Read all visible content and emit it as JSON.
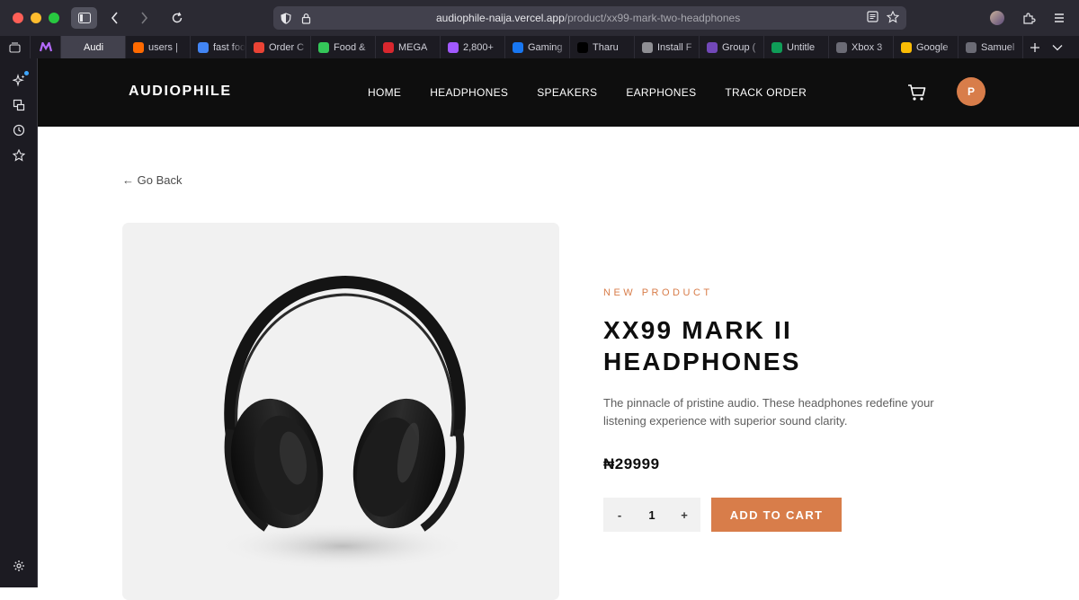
{
  "browser": {
    "url_host": "audiophile-naija.vercel.app",
    "url_path": "/product/xx99-mark-two-headphones",
    "tabs": [
      {
        "label": "Audi",
        "icon": "audiophile-favicon",
        "active": true,
        "color": "#42414d"
      },
      {
        "label": "users | ",
        "icon": "supabase-favicon",
        "color": "#ff6a00"
      },
      {
        "label": "fast foo",
        "icon": "google-favicon",
        "color": "#4285f4"
      },
      {
        "label": "Order C",
        "icon": "gmail-favicon",
        "color": "#ea4335"
      },
      {
        "label": "Food &",
        "icon": "food-app-favicon",
        "color": "#34c759"
      },
      {
        "label": "MEGA",
        "icon": "mega-favicon",
        "color": "#d9272e"
      },
      {
        "label": "2,800+",
        "icon": "figma-favicon",
        "color": "#a259ff"
      },
      {
        "label": "Gaming",
        "icon": "facebook-favicon",
        "color": "#1877f2"
      },
      {
        "label": "Tharu",
        "icon": "x-favicon",
        "color": "#000000"
      },
      {
        "label": "Install F",
        "icon": "globe-favicon",
        "color": "#8e8e93"
      },
      {
        "label": "Group (",
        "icon": "forms-favicon",
        "color": "#7248b9"
      },
      {
        "label": "Untitle",
        "icon": "sheets-favicon",
        "color": "#0f9d58"
      },
      {
        "label": "Xbox 3",
        "icon": "controller-favicon",
        "color": "#6b6b75"
      },
      {
        "label": "Google",
        "icon": "google-photos-favicon",
        "color": "#fbbc05"
      },
      {
        "label": "Samuel",
        "icon": "pin-favicon",
        "color": "#6b6b75"
      }
    ]
  },
  "nav": {
    "logo": "AUDIOPHILE",
    "links": [
      "HOME",
      "HEADPHONES",
      "SPEAKERS",
      "EARPHONES",
      "TRACK ORDER"
    ],
    "profile_initial": "P"
  },
  "page": {
    "go_back": "← Go Back"
  },
  "product": {
    "overline": "NEW PRODUCT",
    "title": "XX99 MARK II HEADPHONES",
    "description": "The pinnacle of pristine audio. These headphones redefine your listening experience with superior sound clarity.",
    "price": "₦29999",
    "quantity": "1",
    "decrement": "-",
    "increment": "+",
    "add_to_cart": "ADD TO CART"
  },
  "colors": {
    "accent": "#d87d4a",
    "nav_bg": "#0e0e0e",
    "image_bg": "#f1f1f1"
  }
}
